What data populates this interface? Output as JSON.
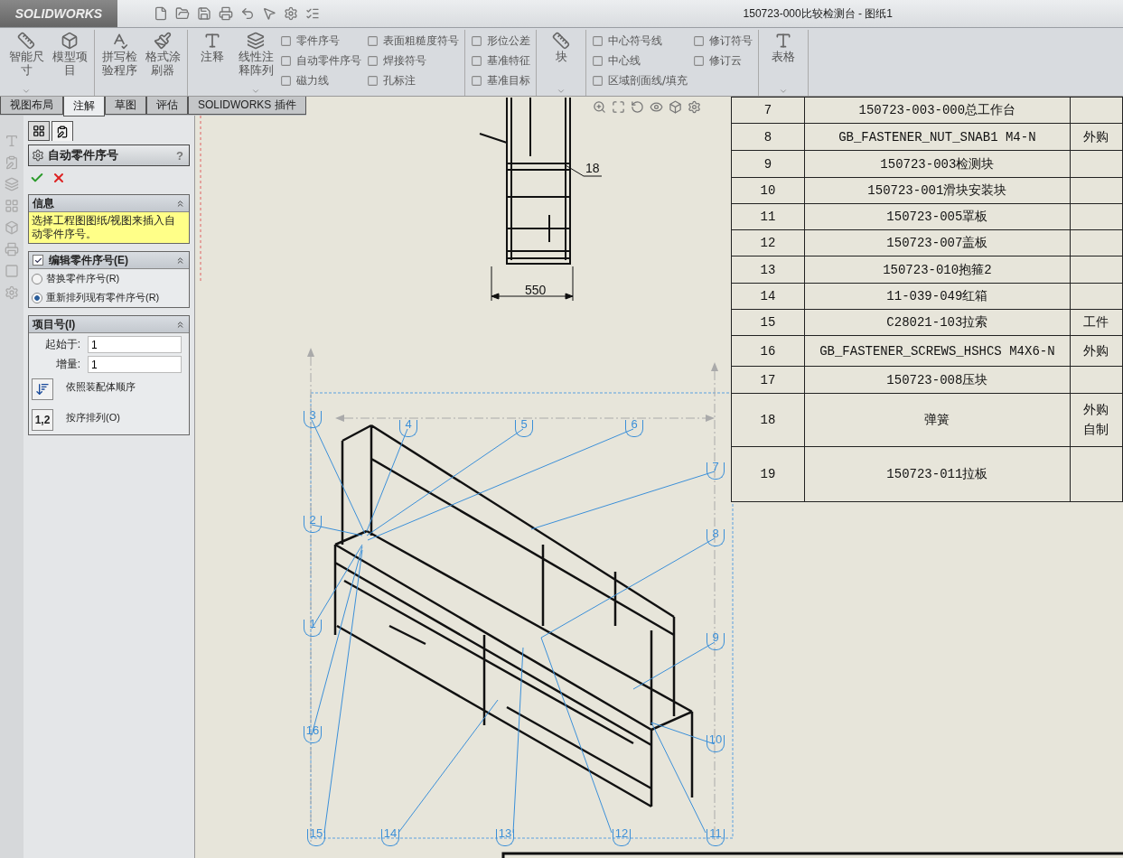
{
  "app": {
    "logo": "SOLIDWORKS",
    "title": "150723-000比较检测台 - 图纸1"
  },
  "ribbon": {
    "groups": [
      {
        "columns": [
          {
            "kind": "large",
            "label": "智能尺寸",
            "menu": true
          },
          {
            "kind": "large",
            "label": "模型项目",
            "menu": false
          }
        ]
      },
      {
        "columns": [
          {
            "kind": "large",
            "label": "拼写检验程序",
            "menu": false
          },
          {
            "kind": "large",
            "label": "格式涂刷器",
            "menu": false
          }
        ]
      },
      {
        "columns": [
          {
            "kind": "large",
            "label": "注释",
            "menu": false
          },
          {
            "kind": "large",
            "label": "线性注释阵列",
            "menu": true
          },
          {
            "kind": "small",
            "items": [
              "零件序号",
              "自动零件序号",
              "磁力线"
            ]
          },
          {
            "kind": "small",
            "items": [
              "表面粗糙度符号",
              "焊接符号",
              "孔标注"
            ]
          }
        ]
      },
      {
        "columns": [
          {
            "kind": "small",
            "items": [
              "形位公差",
              "基准特征",
              "基准目标"
            ]
          }
        ]
      },
      {
        "columns": [
          {
            "kind": "large",
            "label": "块",
            "menu": true
          }
        ]
      },
      {
        "columns": [
          {
            "kind": "small",
            "items": [
              "中心符号线",
              "中心线",
              "区域剖面线/填充"
            ]
          },
          {
            "kind": "small",
            "items": [
              "修订符号",
              "修订云"
            ]
          }
        ]
      },
      {
        "columns": [
          {
            "kind": "large",
            "label": "表格",
            "menu": true
          }
        ]
      }
    ]
  },
  "tabs": [
    {
      "label": "视图布局",
      "selected": false
    },
    {
      "label": "注解",
      "selected": true
    },
    {
      "label": "草图",
      "selected": false
    },
    {
      "label": "评估",
      "selected": false
    },
    {
      "label": "SOLIDWORKS 插件",
      "selected": false
    }
  ],
  "panel": {
    "tabs": [
      {
        "selected": false
      },
      {
        "selected": true
      }
    ],
    "title": "自动零件序号",
    "help": "?",
    "info": {
      "title": "信息",
      "message": "选择工程图图纸/视图来插入自动零件序号。"
    },
    "edit": {
      "title": "编辑零件序号(E)",
      "checked": true,
      "options": [
        {
          "label": "替换零件序号(R)",
          "selected": false
        },
        {
          "label": "重新排列现有零件序号(R)",
          "selected": true
        }
      ]
    },
    "numbering": {
      "title": "项目号(I)",
      "fields": [
        {
          "label": "起始于:",
          "value": "1"
        },
        {
          "label": "增量:",
          "value": "1"
        }
      ],
      "orders": [
        {
          "kind": "assembly",
          "label": "依照装配体顺序"
        },
        {
          "kind": "sequence",
          "key": "1,2",
          "label": "按序排列(O)"
        }
      ]
    }
  },
  "drawing": {
    "top_view": {
      "balloon": "18",
      "dimension": "550"
    },
    "balloons": [
      "3",
      "4",
      "5",
      "6",
      "7",
      "2",
      "8",
      "1",
      "9",
      "16",
      "10",
      "15",
      "14",
      "13",
      "12",
      "11"
    ]
  },
  "bom": {
    "rows": [
      {
        "item": "7",
        "name": "150723-003-000总工作台",
        "note": ""
      },
      {
        "item": "8",
        "name": "GB_FASTENER_NUT_SNAB1 M4-N",
        "note": "外购"
      },
      {
        "item": "9",
        "name": "150723-003检测块",
        "note": ""
      },
      {
        "item": "10",
        "name": "150723-001滑块安装块",
        "note": ""
      },
      {
        "item": "11",
        "name": "150723-005罩板",
        "note": ""
      },
      {
        "item": "12",
        "name": "150723-007盖板",
        "note": ""
      },
      {
        "item": "13",
        "name": "150723-010抱箍2",
        "note": ""
      },
      {
        "item": "14",
        "name": "11-039-049红箱",
        "note": ""
      },
      {
        "item": "15",
        "name": "C28021-103拉索",
        "note": "工件"
      },
      {
        "item": "16",
        "name": "GB_FASTENER_SCREWS_HSHCS M4X6-N",
        "note": "外购"
      },
      {
        "item": "17",
        "name": "150723-008压块",
        "note": ""
      },
      {
        "item": "18",
        "name": "弹簧",
        "note": "外购自制"
      },
      {
        "item": "19",
        "name": "150723-011拉板",
        "note": ""
      }
    ]
  }
}
